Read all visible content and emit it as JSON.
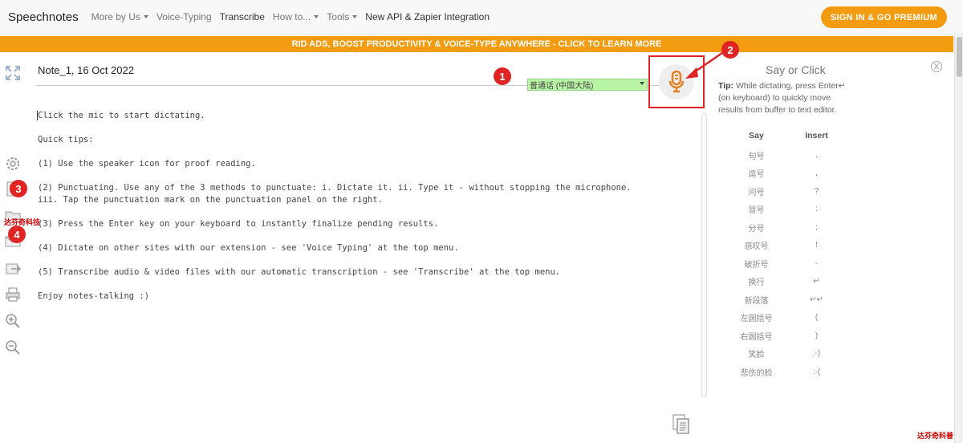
{
  "nav": {
    "brand": "Speechnotes",
    "items": [
      {
        "label": "More by Us",
        "caret": true,
        "dark": false
      },
      {
        "label": "Voice-Typing",
        "caret": false,
        "dark": false
      },
      {
        "label": "Transcribe",
        "caret": false,
        "dark": true
      },
      {
        "label": "How to...",
        "caret": true,
        "dark": false
      },
      {
        "label": "Tools",
        "caret": true,
        "dark": false
      },
      {
        "label": "New API & Zapier Integration",
        "caret": false,
        "dark": true
      }
    ],
    "signin": "SIGN IN & GO PREMIUM"
  },
  "banner": "RID ADS, BOOST PRODUCTIVITY & VOICE-TYPE ANYWHERE - CLICK TO LEARN MORE",
  "note": {
    "title": "Note_1, 16 Oct 2022",
    "language": "普通话 (中国大陆)"
  },
  "editor": {
    "lines": [
      "Click the mic to start dictating.",
      "Quick tips:",
      "(1) Use the speaker icon for proof reading.",
      "(2) Punctuating. Use any of the 3 methods to punctuate: i. Dictate it. ii. Type it - without stopping the microphone. iii. Tap the punctuation mark on the punctuation panel on the right.",
      "(3) Press the Enter key on your keyboard to instantly finalize pending results.",
      "(4) Dictate on other sites with our extension - see 'Voice Typing' at the top menu.",
      "(5) Transcribe audio & video files with our automatic transcription - see 'Transcribe' at the top menu.",
      "Enjoy notes-talking :)"
    ]
  },
  "panel": {
    "heading": "Say or Click",
    "close": "X",
    "tip_label": "Tip:",
    "tip_text": " While dictating, press Enter↵ (on keyboard) to quickly move results from buffer to text editor.",
    "col_say": "Say",
    "col_insert": "Insert",
    "rows": [
      {
        "say": "句号",
        "insert": "."
      },
      {
        "say": "逗号",
        "insert": ","
      },
      {
        "say": "问号",
        "insert": "?"
      },
      {
        "say": "冒号",
        "insert": ":"
      },
      {
        "say": "分号",
        "insert": ";"
      },
      {
        "say": "感叹号",
        "insert": "!"
      },
      {
        "say": "破折号",
        "insert": "-"
      },
      {
        "say": "换行",
        "insert": "↵"
      },
      {
        "say": "新段落",
        "insert": "↵↵"
      },
      {
        "say": "左圆括号",
        "insert": "("
      },
      {
        "say": "右圆括号",
        "insert": ")"
      },
      {
        "say": "笑脸",
        "insert": ":-)"
      },
      {
        "say": "悲伤的脸",
        "insert": ":-("
      }
    ]
  },
  "badges": [
    "1",
    "2",
    "3",
    "4"
  ],
  "watermark": "达芬奇科技",
  "watermark2": "达芬奇科普",
  "icons": [
    "fullscreen-icon",
    "settings-icon",
    "new-note-icon",
    "open-folder-icon",
    "email-icon",
    "export-icon",
    "print-icon",
    "zoom-in-icon",
    "zoom-out-icon",
    "microphone-icon",
    "copy-icon"
  ],
  "colors": {
    "accent": "#f39c12",
    "annotation": "#e02424",
    "language_bg": "#b9f5a5"
  }
}
